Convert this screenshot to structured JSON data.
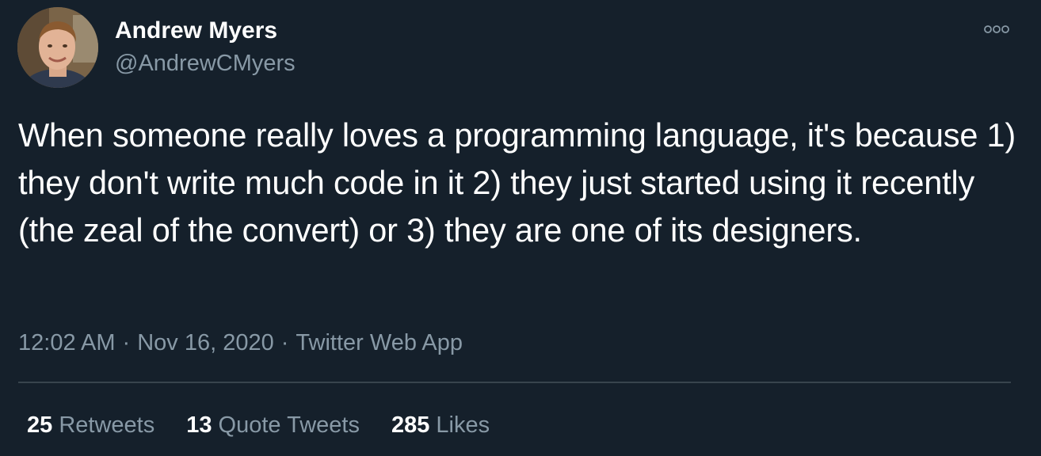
{
  "author": {
    "display_name": "Andrew Myers",
    "handle": "@AndrewCMyers",
    "avatar_icon": "user-avatar"
  },
  "tweet": {
    "text": "When someone really loves a programming language, it's because 1) they don't write much code in it 2) they just started using it recently (the zeal of the convert) or 3) they are one of its designers.",
    "time": "12:02 AM",
    "date": "Nov 16, 2020",
    "source": "Twitter Web App",
    "separator": "·"
  },
  "stats": {
    "retweets_count": "25",
    "retweets_label": "Retweets",
    "quote_count": "13",
    "quote_label": "Quote Tweets",
    "likes_count": "285",
    "likes_label": "Likes"
  },
  "menu": {
    "icon": "more-options-icon"
  },
  "colors": {
    "background": "#15202b",
    "primary_text": "#ffffff",
    "secondary_text": "#8899a6",
    "divider": "#38444d"
  }
}
